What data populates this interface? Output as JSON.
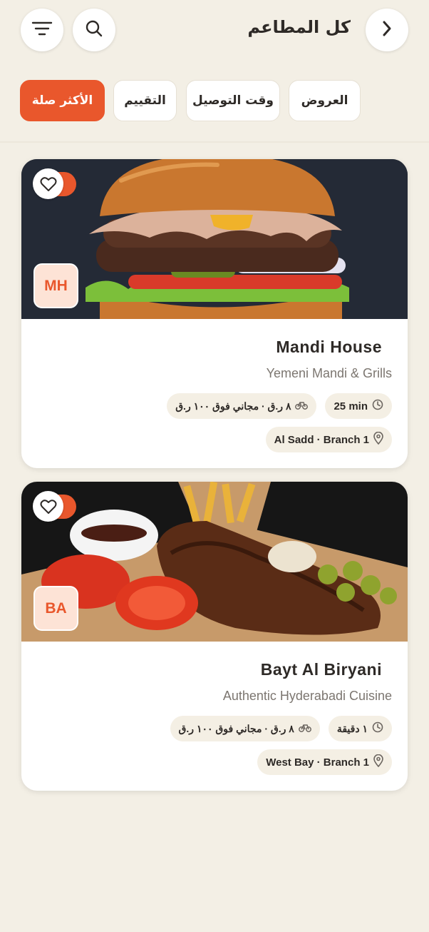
{
  "header": {
    "title": "كل المطاعم"
  },
  "chips": [
    {
      "label": "الأكثر صلة",
      "active": true
    },
    {
      "label": "التقييم",
      "active": false
    },
    {
      "label": "وقت التوصيل",
      "active": false
    },
    {
      "label": "العروض",
      "active": false
    }
  ],
  "restaurants": [
    {
      "initials": "MH",
      "name": "Mandi House",
      "cuisine": "Yemeni Mandi & Grills",
      "delivery_fee": "٨ ر.ق · مجاني فوق ١٠٠ ر.ق",
      "time": "25 min",
      "location": "Al Sadd · Branch 1"
    },
    {
      "initials": "BA",
      "name": "Bayt Al Biryani",
      "cuisine": "Authentic Hyderabadi Cuisine",
      "delivery_fee": "٨ ر.ق · مجاني فوق ١٠٠ ر.ق",
      "time": "١ دقيقة",
      "location": "West Bay · Branch 1"
    }
  ],
  "colors": {
    "accent": "#e9572c",
    "background": "#f3efe5",
    "card": "#ffffff",
    "tag": "#f4efe4"
  },
  "icons": {
    "filter": "filter-icon",
    "search": "search-icon",
    "back": "chevron-right-icon",
    "favorite": "heart-icon",
    "clock": "clock-icon",
    "bike": "bike-icon",
    "location": "location-pin-icon"
  }
}
